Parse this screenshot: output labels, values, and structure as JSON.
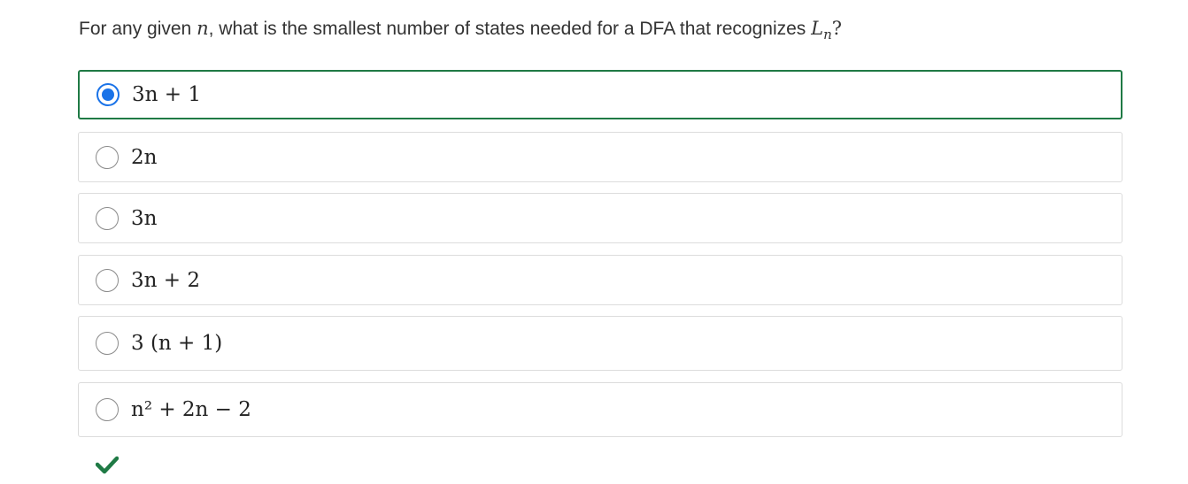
{
  "question": {
    "prefix": "For any given ",
    "var": "n",
    "middle": ", what is the smallest number of states needed for a DFA that recognizes ",
    "lang": "L",
    "lang_sub": "n",
    "suffix": "?"
  },
  "options": [
    {
      "label": "3n + 1",
      "selected": true
    },
    {
      "label": "2n",
      "selected": false
    },
    {
      "label": "3n",
      "selected": false
    },
    {
      "label": "3n + 2",
      "selected": false
    },
    {
      "label": "3 (n + 1)",
      "selected": false
    },
    {
      "label": "n² + 2n − 2",
      "selected": false
    }
  ],
  "feedback": {
    "icon": "checkmark-icon",
    "color": "#1f7a45"
  },
  "colors": {
    "selected_border": "#1f7a45",
    "radio_accent": "#1a73e8"
  }
}
